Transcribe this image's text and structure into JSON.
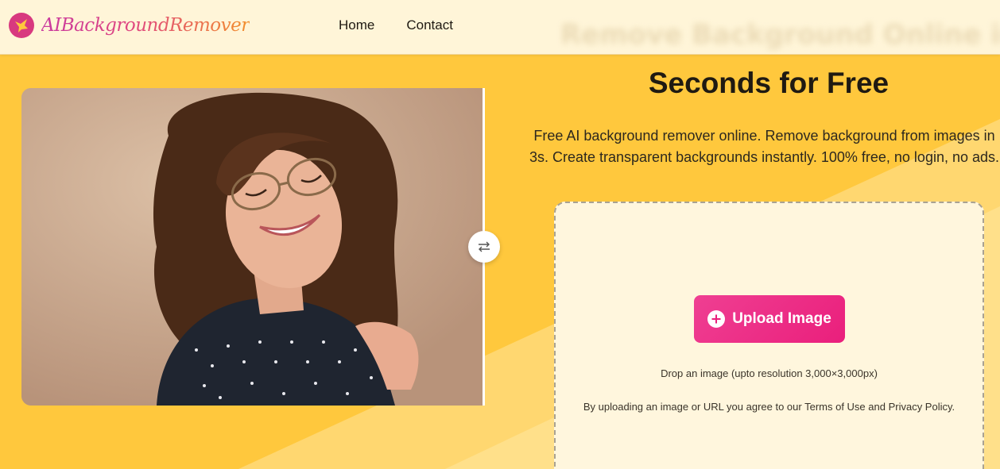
{
  "header": {
    "logo_text": "AIBackgroundRemover",
    "nav": [
      {
        "label": "Home"
      },
      {
        "label": "Contact"
      }
    ],
    "scrolled_title": "Remove Background Online in"
  },
  "hero": {
    "title": "Seconds for Free",
    "description": "Free AI background remover online. Remove background from images in 3s. Create transparent backgrounds instantly. 100% free, no login, no ads.",
    "image_subject": "Smiling woman with curly hair and glasses"
  },
  "upload": {
    "button_label": "Upload Image",
    "drop_note": "Drop an image (upto resolution 3,000×3,000px)",
    "terms_note": "By uploading an image or URL you agree to our Terms of Use and Privacy Policy."
  },
  "colors": {
    "background": "#ffc83d",
    "header_bg": "#fff5d8",
    "accent": "#ea1f7c",
    "panel_bg": "#fff6dd"
  },
  "icons": {
    "logo": "bird-logo-icon",
    "swap": "swap-arrows-icon",
    "upload": "plus-circle-icon"
  }
}
